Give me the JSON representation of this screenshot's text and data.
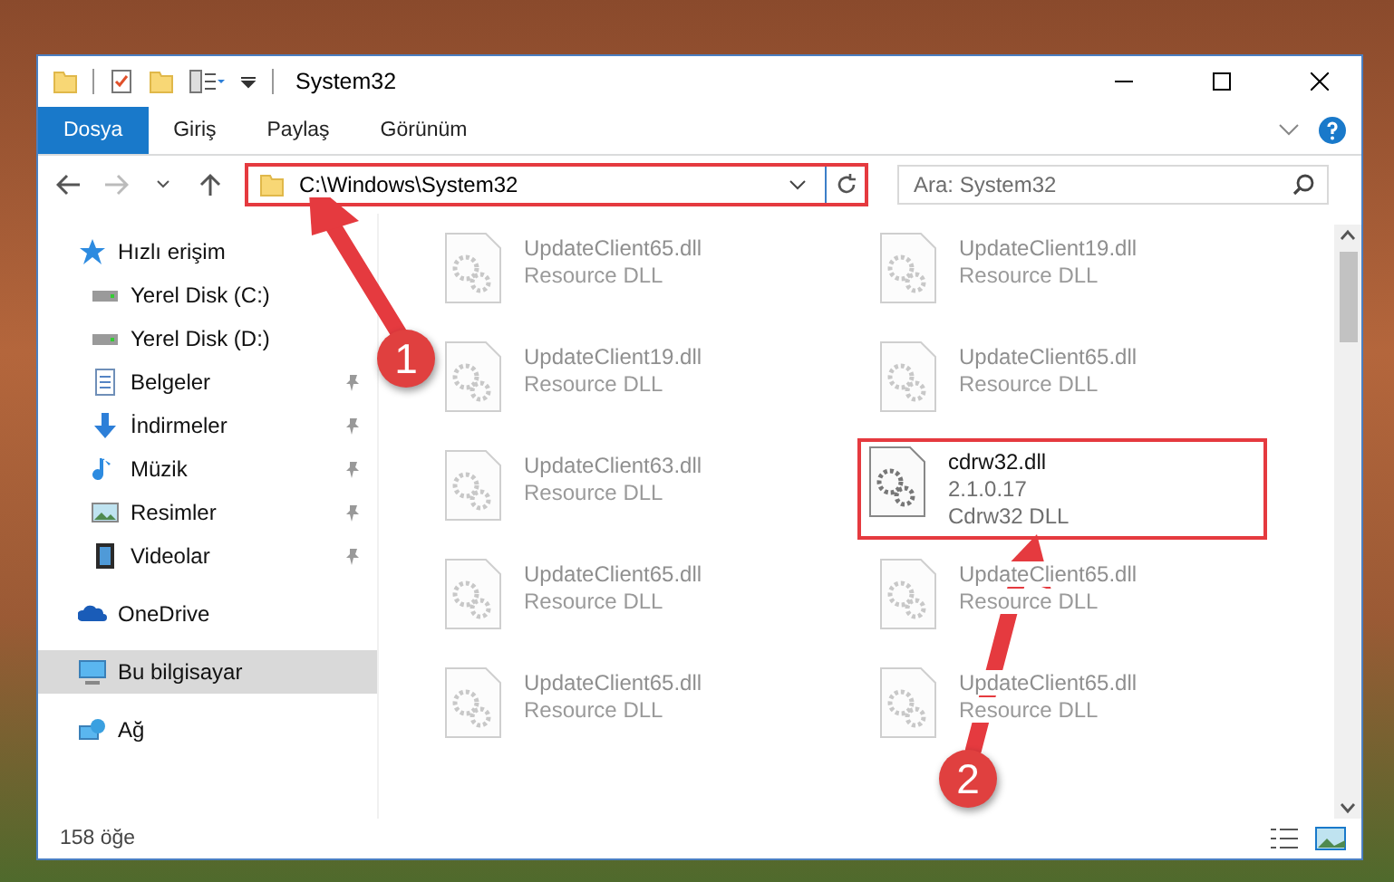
{
  "window": {
    "title": "System32"
  },
  "ribbon": {
    "tabs": [
      {
        "label": "Dosya",
        "selected": true
      },
      {
        "label": "Giriş",
        "selected": false
      },
      {
        "label": "Paylaş",
        "selected": false
      },
      {
        "label": "Görünüm",
        "selected": false
      }
    ]
  },
  "address": {
    "path": "C:\\Windows\\System32",
    "highlighted": true
  },
  "search": {
    "placeholder": "Ara: System32"
  },
  "sidebar": {
    "items": [
      {
        "label": "Hızlı erişim",
        "kind": "star",
        "selected": false,
        "pinned": false,
        "children": [
          {
            "label": "Yerel Disk (C:)",
            "kind": "drive",
            "selected": false,
            "pinned": false
          },
          {
            "label": "Yerel Disk (D:)",
            "kind": "drive",
            "selected": false,
            "pinned": false
          },
          {
            "label": "Belgeler",
            "kind": "document",
            "selected": false,
            "pinned": true
          },
          {
            "label": "İndirmeler",
            "kind": "download",
            "selected": false,
            "pinned": true
          },
          {
            "label": "Müzik",
            "kind": "music",
            "selected": false,
            "pinned": true
          },
          {
            "label": "Resimler",
            "kind": "picture",
            "selected": false,
            "pinned": true
          },
          {
            "label": "Videolar",
            "kind": "video",
            "selected": false,
            "pinned": true
          }
        ]
      },
      {
        "label": "OneDrive",
        "kind": "cloud",
        "selected": false,
        "pinned": false
      },
      {
        "label": "Bu bilgisayar",
        "kind": "computer",
        "selected": true,
        "pinned": false
      },
      {
        "label": "Ağ",
        "kind": "network",
        "selected": false,
        "pinned": false
      }
    ]
  },
  "files": [
    {
      "name": "UpdateClient65.dll",
      "lines": [
        "Resource DLL"
      ],
      "dimmed": true,
      "highlighted": false
    },
    {
      "name": "UpdateClient19.dll",
      "lines": [
        "Resource DLL"
      ],
      "dimmed": true,
      "highlighted": false
    },
    {
      "name": "UpdateClient19.dll",
      "lines": [
        "Resource DLL"
      ],
      "dimmed": true,
      "highlighted": false
    },
    {
      "name": "UpdateClient65.dll",
      "lines": [
        "Resource DLL"
      ],
      "dimmed": true,
      "highlighted": false
    },
    {
      "name": "UpdateClient63.dll",
      "lines": [
        "Resource DLL"
      ],
      "dimmed": true,
      "highlighted": false
    },
    {
      "name": "cdrw32.dll",
      "lines": [
        "2.1.0.17",
        "Cdrw32 DLL"
      ],
      "dimmed": false,
      "highlighted": true
    },
    {
      "name": "UpdateClient65.dll",
      "lines": [
        "Resource DLL"
      ],
      "dimmed": true,
      "highlighted": false
    },
    {
      "name": "UpdateClient65.dll",
      "lines": [
        "Resource DLL"
      ],
      "dimmed": true,
      "highlighted": false
    },
    {
      "name": "UpdateClient65.dll",
      "lines": [
        "Resource DLL"
      ],
      "dimmed": true,
      "highlighted": false
    },
    {
      "name": "UpdateClient65.dll",
      "lines": [
        "Resource DLL"
      ],
      "dimmed": true,
      "highlighted": false
    }
  ],
  "status_bar": {
    "count": "158 öğe"
  },
  "annotations": [
    {
      "label": "1"
    },
    {
      "label": "2"
    }
  ]
}
